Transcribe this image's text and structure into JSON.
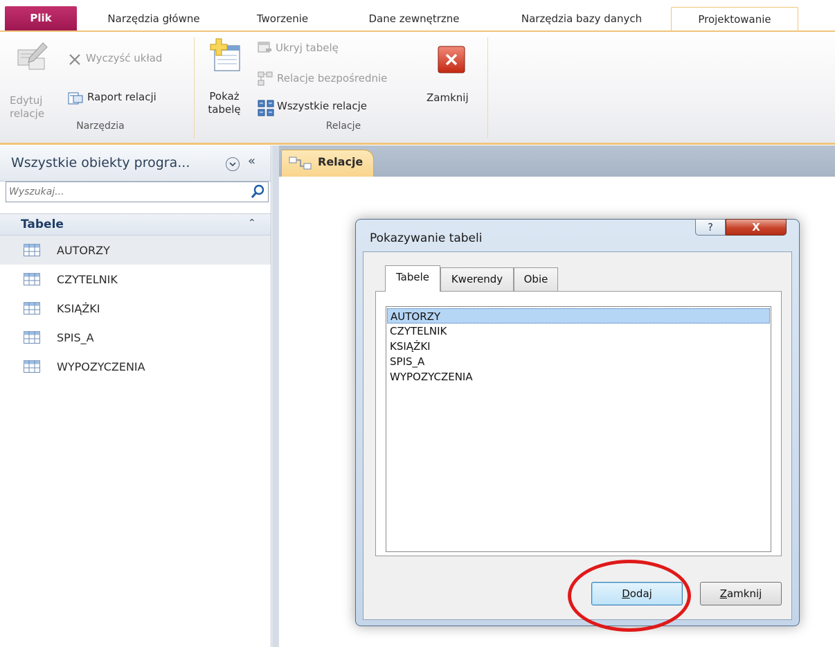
{
  "ribbon_tabs": [
    {
      "label": "Plik"
    },
    {
      "label": "Narzędzia główne"
    },
    {
      "label": "Tworzenie"
    },
    {
      "label": "Dane zewnętrzne"
    },
    {
      "label": "Narzędzia bazy danych"
    },
    {
      "label": "Projektowanie"
    }
  ],
  "ribbon": {
    "tools_group": {
      "label": "Narzędzia",
      "edit_relations": "Edytuj relacje",
      "clear_layout": "Wyczyść układ",
      "relations_report": "Raport relacji"
    },
    "relations_group": {
      "label": "Relacje",
      "show_table": "Pokaż tabelę",
      "hide_table": "Ukryj tabelę",
      "direct_relations": "Relacje bezpośrednie",
      "all_relations": "Wszystkie relacje",
      "close": "Zamknij"
    }
  },
  "nav": {
    "title": "Wszystkie obiekty progra...",
    "collapse_glyph": "«",
    "search_placeholder": "Wyszukaj...",
    "group_label": "Tabele",
    "group_chevron": "⌃",
    "items": [
      "AUTORZY",
      "CZYTELNIK",
      "KSIĄŻKI",
      "SPIS_A",
      "WYPOZYCZENIA"
    ]
  },
  "document_tab": {
    "label": "Relacje"
  },
  "dialog": {
    "title": "Pokazywanie tabeli",
    "help_glyph": "?",
    "close_glyph": "X",
    "tabs": [
      "Tabele",
      "Kwerendy",
      "Obie"
    ],
    "list_items": [
      "AUTORZY",
      "CZYTELNIK",
      "KSIĄŻKI",
      "SPIS_A",
      "WYPOZYCZENIA"
    ],
    "add_button": {
      "accel": "D",
      "rest": "odaj"
    },
    "close_button": {
      "accel": "Z",
      "rest": "amknij"
    }
  },
  "colors": {
    "file_tab": "#b01e5c",
    "accent_orange": "#f0c47a",
    "annotation": "#e01919",
    "selection": "#b6d6f5"
  }
}
